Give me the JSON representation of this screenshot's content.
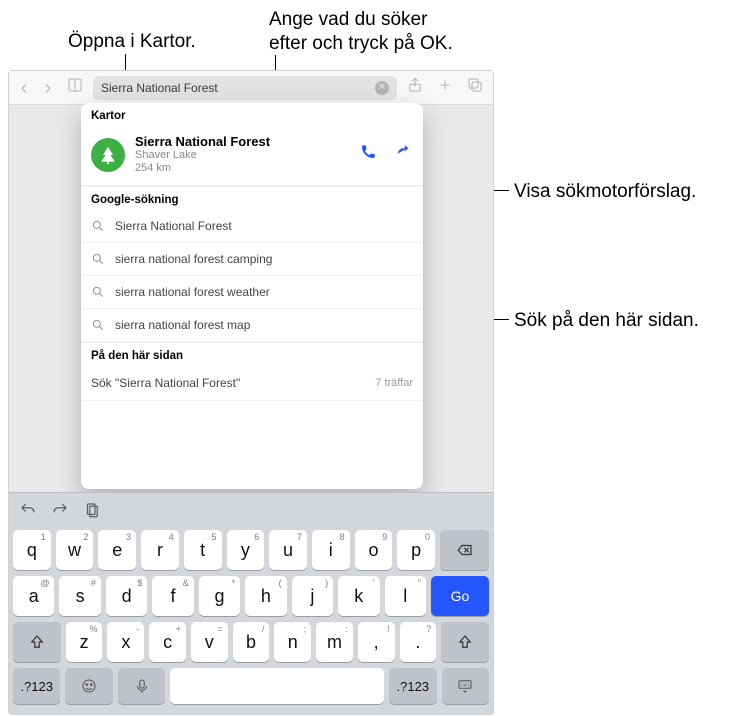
{
  "callouts": {
    "open_maps": "Öppna i Kartor.",
    "search_hint_line1": "Ange vad du söker",
    "search_hint_line2": "efter och tryck på OK.",
    "show_engine": "Visa sökmotorförslag.",
    "search_page": "Sök på den här sidan."
  },
  "address_bar": {
    "value": "Sierra National Forest"
  },
  "panel": {
    "maps_header": "Kartor",
    "maps_title": "Sierra National Forest",
    "maps_sub1": "Shaver Lake",
    "maps_sub2": "254 km",
    "google_header": "Google-sökning",
    "suggestions": [
      "Sierra National Forest",
      "sierra national forest camping",
      "sierra national forest weather",
      "sierra national forest map"
    ],
    "onpage_header": "På den här sidan",
    "onpage_text": "Sök \"Sierra National Forest\"",
    "onpage_hits": "7 träffar"
  },
  "keyboard": {
    "go": "Go",
    "mode": ".?123",
    "row1": [
      {
        "m": "q",
        "s": "1"
      },
      {
        "m": "w",
        "s": "2"
      },
      {
        "m": "e",
        "s": "3"
      },
      {
        "m": "r",
        "s": "4"
      },
      {
        "m": "t",
        "s": "5"
      },
      {
        "m": "y",
        "s": "6"
      },
      {
        "m": "u",
        "s": "7"
      },
      {
        "m": "i",
        "s": "8"
      },
      {
        "m": "o",
        "s": "9"
      },
      {
        "m": "p",
        "s": "0"
      }
    ],
    "row2": [
      {
        "m": "a",
        "s": "@"
      },
      {
        "m": "s",
        "s": "#"
      },
      {
        "m": "d",
        "s": "$"
      },
      {
        "m": "f",
        "s": "&"
      },
      {
        "m": "g",
        "s": "*"
      },
      {
        "m": "h",
        "s": "("
      },
      {
        "m": "j",
        "s": ")"
      },
      {
        "m": "k",
        "s": "'"
      },
      {
        "m": "l",
        "s": "\""
      }
    ],
    "row3": [
      {
        "m": "z",
        "s": "%"
      },
      {
        "m": "x",
        "s": "-"
      },
      {
        "m": "c",
        "s": "+"
      },
      {
        "m": "v",
        "s": "="
      },
      {
        "m": "b",
        "s": "/"
      },
      {
        "m": "n",
        "s": ";"
      },
      {
        "m": "m",
        "s": ":"
      },
      {
        "m": ",",
        "s": "!"
      },
      {
        "m": ".",
        "s": "?"
      }
    ]
  }
}
